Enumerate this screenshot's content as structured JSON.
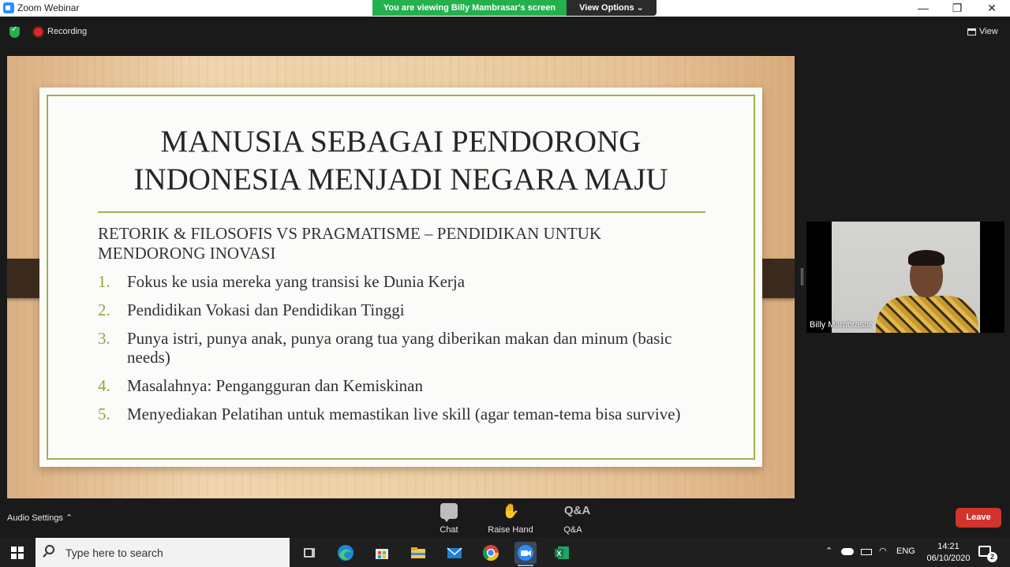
{
  "window": {
    "title": "Zoom Webinar",
    "controls": {
      "minimize": "—",
      "restore": "❐",
      "close": "✕"
    }
  },
  "share_banner": {
    "viewing_text": "You are viewing Billy Mambrasar's screen",
    "view_options": "View Options ⌄"
  },
  "status": {
    "recording": "Recording",
    "view": "View"
  },
  "slide": {
    "title_line1": "MANUSIA SEBAGAI PENDORONG",
    "title_line2": "INDONESIA MENJADI NEGARA MAJU",
    "subtitle": "RETORIK & FILOSOFIS VS PRAGMATISME – PENDIDIKAN UNTUK MENDORONG INOVASI",
    "points": [
      {
        "num": "1.",
        "text": "Fokus ke usia mereka yang transisi ke Dunia Kerja"
      },
      {
        "num": "2.",
        "text": "Pendidikan Vokasi dan Pendidikan Tinggi"
      },
      {
        "num": "3.",
        "text": "Punya istri, punya anak, punya orang tua yang diberikan makan dan minum (basic needs)"
      },
      {
        "num": "4.",
        "text": "Masalahnya: Pengangguran dan Kemiskinan"
      },
      {
        "num": "5.",
        "text": "Menyediakan Pelatihan untuk memastikan live skill (agar teman-tema bisa survive)"
      }
    ]
  },
  "video": {
    "name": "Billy Mambrasar"
  },
  "toolbar": {
    "audio_settings": "Audio Settings ⌃",
    "chat": "Chat",
    "raise_hand": "Raise Hand",
    "qa": "Q&A",
    "qa_icon": "Q&A",
    "leave": "Leave"
  },
  "taskbar": {
    "search_placeholder": "Type here to search",
    "language": "ENG",
    "time": "14:21",
    "date": "06/10/2020",
    "notifications": "2",
    "apps": [
      "task-view",
      "edge",
      "store",
      "file-explorer",
      "mail",
      "chrome",
      "zoom",
      "excel"
    ]
  },
  "colors": {
    "accent_green": "#23b14d",
    "slide_green": "#9bb34c",
    "leave_red": "#d1332d",
    "recording_red": "#e02828"
  }
}
